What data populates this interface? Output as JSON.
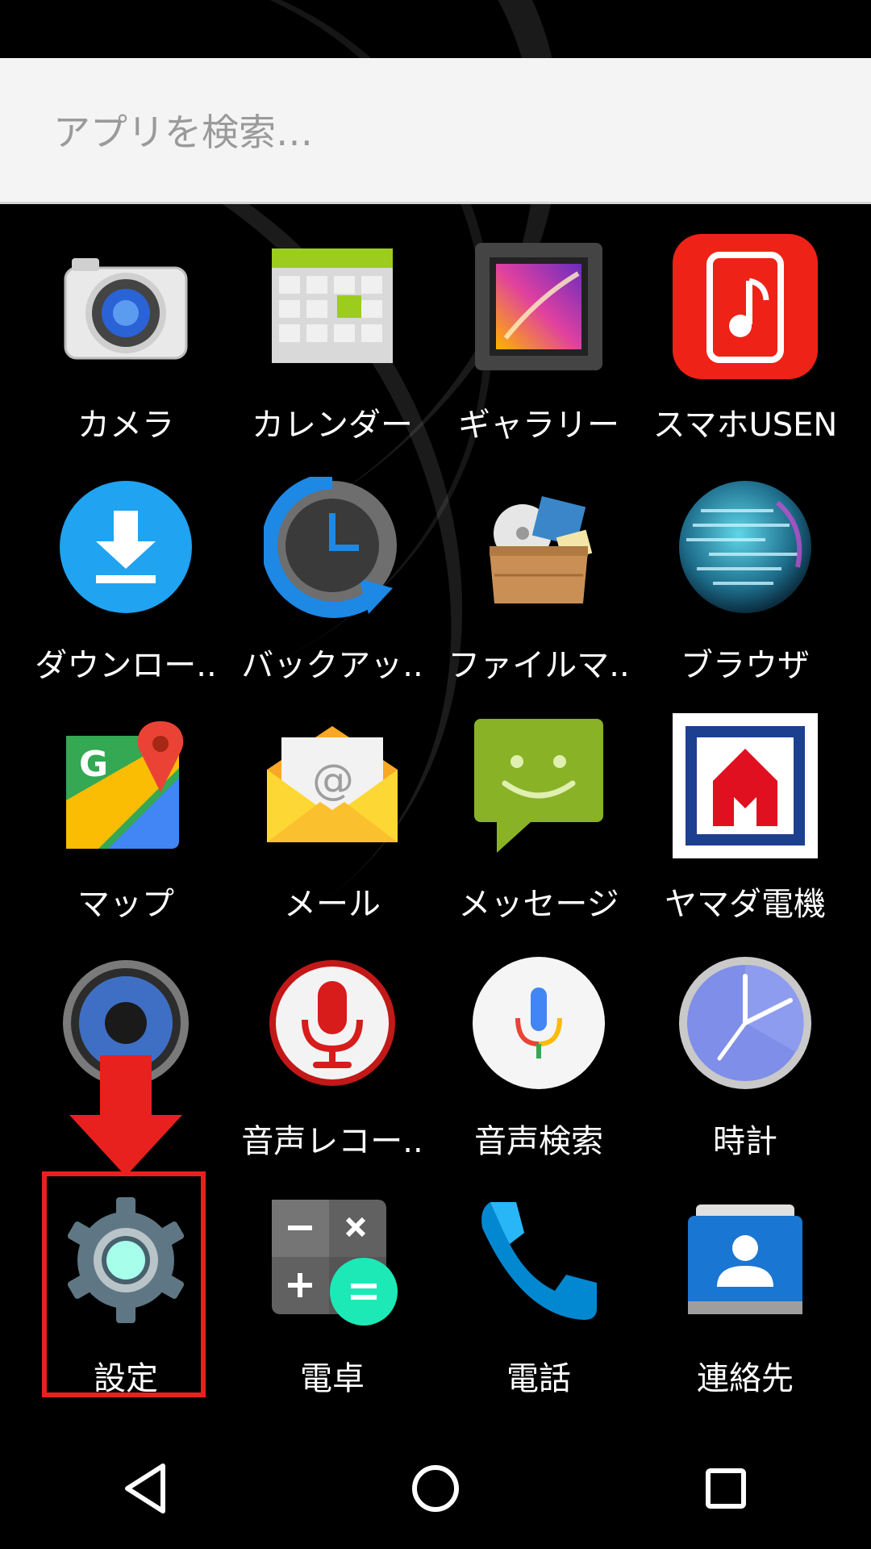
{
  "search": {
    "placeholder": "アプリを検索…"
  },
  "apps": [
    {
      "label": "カメラ",
      "icon": "camera-icon"
    },
    {
      "label": "カレンダー",
      "icon": "calendar-icon"
    },
    {
      "label": "ギャラリー",
      "icon": "gallery-icon"
    },
    {
      "label": "スマホUSEN",
      "icon": "usen-icon"
    },
    {
      "label": "ダウンロー..",
      "icon": "download-icon"
    },
    {
      "label": "バックアッ..",
      "icon": "backup-icon"
    },
    {
      "label": "ファイルマ..",
      "icon": "file-manager-icon"
    },
    {
      "label": "ブラウザ",
      "icon": "browser-icon"
    },
    {
      "label": "マップ",
      "icon": "maps-icon"
    },
    {
      "label": "メール",
      "icon": "mail-icon"
    },
    {
      "label": "メッセージ",
      "icon": "messages-icon"
    },
    {
      "label": "ヤマダ電機",
      "icon": "yamada-icon"
    },
    {
      "label": "",
      "icon": "speaker-icon"
    },
    {
      "label": "音声レコー..",
      "icon": "voice-recorder-icon"
    },
    {
      "label": "音声検索",
      "icon": "voice-search-icon"
    },
    {
      "label": "時計",
      "icon": "clock-icon"
    },
    {
      "label": "設定",
      "icon": "settings-icon"
    },
    {
      "label": "電卓",
      "icon": "calculator-icon"
    },
    {
      "label": "電話",
      "icon": "phone-icon"
    },
    {
      "label": "連絡先",
      "icon": "contacts-icon"
    }
  ],
  "annotation": {
    "color": "#e8211e"
  },
  "navbar": {
    "back": "back-icon",
    "home": "home-icon",
    "recents": "recents-icon"
  }
}
